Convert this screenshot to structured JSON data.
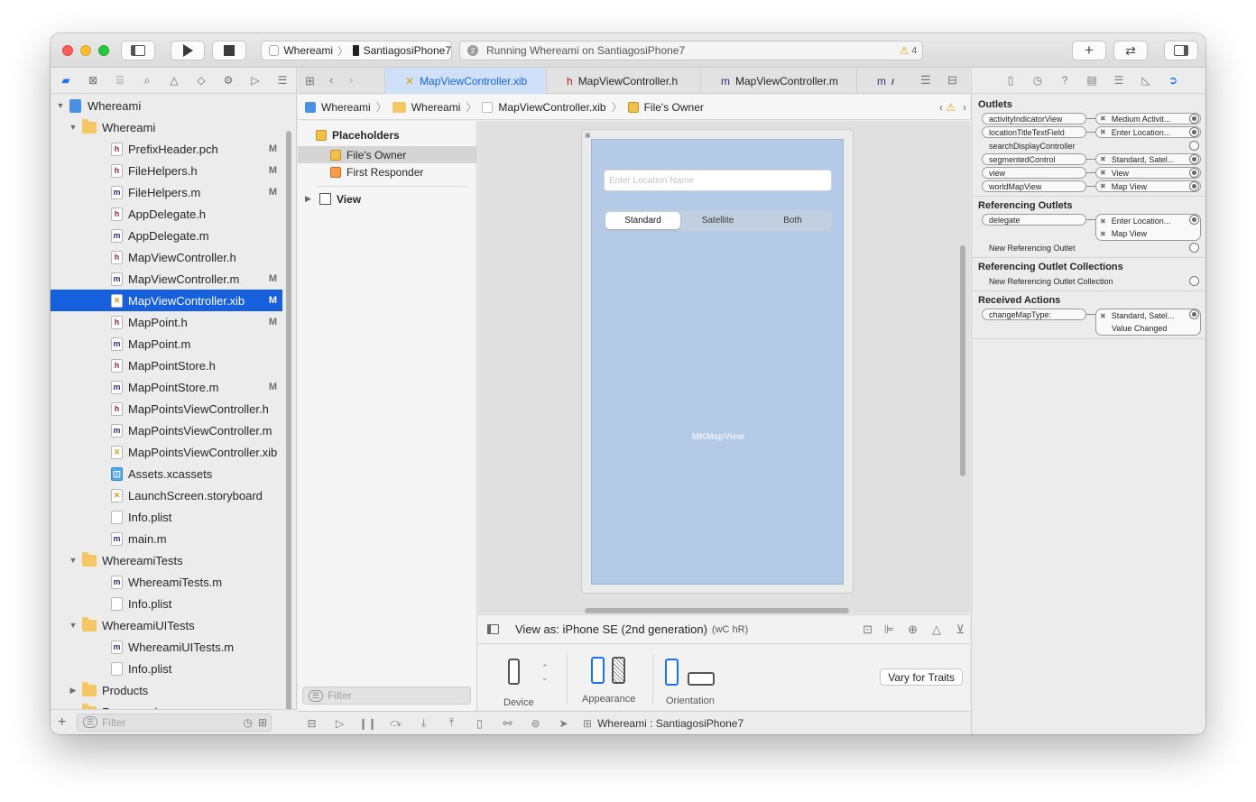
{
  "toolbar": {
    "scheme_project": "Whereami",
    "scheme_device": "SantiagosiPhone7",
    "status_num": "2",
    "status_text": "Running Whereami on SantiagosiPhone7",
    "warning_count": "4"
  },
  "navigator": {
    "tree": [
      {
        "label": "Whereami",
        "kind": "project",
        "indent": 0,
        "disclosure": "▼",
        "badge": ""
      },
      {
        "label": "Whereami",
        "kind": "folder",
        "indent": 1,
        "disclosure": "▼",
        "badge": ""
      },
      {
        "label": "PrefixHeader.pch",
        "kind": "h",
        "indent": 2,
        "badge": "M"
      },
      {
        "label": "FileHelpers.h",
        "kind": "h",
        "indent": 2,
        "badge": "M"
      },
      {
        "label": "FileHelpers.m",
        "kind": "m",
        "indent": 2,
        "badge": "M"
      },
      {
        "label": "AppDelegate.h",
        "kind": "h",
        "indent": 2,
        "badge": ""
      },
      {
        "label": "AppDelegate.m",
        "kind": "m",
        "indent": 2,
        "badge": ""
      },
      {
        "label": "MapViewController.h",
        "kind": "h",
        "indent": 2,
        "badge": ""
      },
      {
        "label": "MapViewController.m",
        "kind": "m",
        "indent": 2,
        "badge": "M"
      },
      {
        "label": "MapViewController.xib",
        "kind": "x",
        "indent": 2,
        "badge": "M",
        "selected": true
      },
      {
        "label": "MapPoint.h",
        "kind": "h",
        "indent": 2,
        "badge": "M"
      },
      {
        "label": "MapPoint.m",
        "kind": "m",
        "indent": 2,
        "badge": ""
      },
      {
        "label": "MapPointStore.h",
        "kind": "h",
        "indent": 2,
        "badge": ""
      },
      {
        "label": "MapPointStore.m",
        "kind": "m",
        "indent": 2,
        "badge": "M"
      },
      {
        "label": "MapPointsViewController.h",
        "kind": "h",
        "indent": 2,
        "badge": ""
      },
      {
        "label": "MapPointsViewController.m",
        "kind": "m",
        "indent": 2,
        "badge": ""
      },
      {
        "label": "MapPointsViewController.xib",
        "kind": "x",
        "indent": 2,
        "badge": ""
      },
      {
        "label": "Assets.xcassets",
        "kind": "asset",
        "indent": 2,
        "badge": ""
      },
      {
        "label": "LaunchScreen.storyboard",
        "kind": "x",
        "indent": 2,
        "badge": ""
      },
      {
        "label": "Info.plist",
        "kind": "plain",
        "indent": 2,
        "badge": ""
      },
      {
        "label": "main.m",
        "kind": "m",
        "indent": 2,
        "badge": ""
      },
      {
        "label": "WhereamiTests",
        "kind": "folder",
        "indent": 1,
        "disclosure": "▼",
        "badge": ""
      },
      {
        "label": "WhereamiTests.m",
        "kind": "m",
        "indent": 2,
        "badge": ""
      },
      {
        "label": "Info.plist",
        "kind": "plain",
        "indent": 2,
        "badge": ""
      },
      {
        "label": "WhereamiUITests",
        "kind": "folder",
        "indent": 1,
        "disclosure": "▼",
        "badge": ""
      },
      {
        "label": "WhereamiUITests.m",
        "kind": "m",
        "indent": 2,
        "badge": ""
      },
      {
        "label": "Info.plist",
        "kind": "plain",
        "indent": 2,
        "badge": ""
      },
      {
        "label": "Products",
        "kind": "folder",
        "indent": 1,
        "disclosure": "▶",
        "badge": ""
      },
      {
        "label": "Frameworks",
        "kind": "folder",
        "indent": 1,
        "disclosure": "▶",
        "badge": ""
      }
    ],
    "filter_placeholder": "Filter"
  },
  "editor": {
    "tabs": [
      {
        "label": "MapViewController.xib",
        "kind": "x",
        "active": true
      },
      {
        "label": "MapViewController.h",
        "kind": "h"
      },
      {
        "label": "MapViewController.m",
        "kind": "m"
      },
      {
        "label": "mai",
        "kind": "m"
      }
    ],
    "jumpbar": [
      "Whereami",
      "Whereami",
      "MapViewController.xib",
      "File's Owner"
    ],
    "outline": {
      "section": "Placeholders",
      "files_owner": "File's Owner",
      "first_responder": "First Responder",
      "view": "View",
      "filter_placeholder": "Filter"
    },
    "canvas": {
      "text_field_placeholder": "Enter Location Name",
      "segments": [
        "Standard",
        "Satellite",
        "Both"
      ],
      "map_label": "MKMapView"
    },
    "view_as": {
      "label": "View as: iPhone SE (2nd generation)",
      "size_class": "(wC hR)"
    },
    "device_bar": {
      "device": "Device",
      "appearance": "Appearance",
      "orientation": "Orientation",
      "vary": "Vary for Traits"
    },
    "debug_target": "Whereami : SantiagosiPhone7"
  },
  "inspector": {
    "outlets_title": "Outlets",
    "outlets": [
      {
        "name": "activityIndicatorView",
        "target": "Medium Activit...",
        "connected": true
      },
      {
        "name": "locationTitleTextField",
        "target": "Enter Location...",
        "connected": true
      },
      {
        "name": "searchDisplayController",
        "target": "",
        "connected": false
      },
      {
        "name": "segmentedControl",
        "target": "Standard, Satel...",
        "connected": true
      },
      {
        "name": "view",
        "target": "View",
        "connected": true
      },
      {
        "name": "worldMapView",
        "target": "Map View",
        "connected": true
      }
    ],
    "referencing_title": "Referencing Outlets",
    "referencing": {
      "name": "delegate",
      "targets": [
        "Enter Location...",
        "Map View"
      ]
    },
    "new_referencing": "New Referencing Outlet",
    "collections_title": "Referencing Outlet Collections",
    "new_collection": "New Referencing Outlet Collection",
    "actions_title": "Received Actions",
    "action": {
      "name": "changeMapType:",
      "targets": [
        "Standard, Satel...",
        "Value Changed"
      ]
    }
  },
  "colors": {
    "accent": "#1760dd",
    "canvas_view": "#b5cae6"
  }
}
